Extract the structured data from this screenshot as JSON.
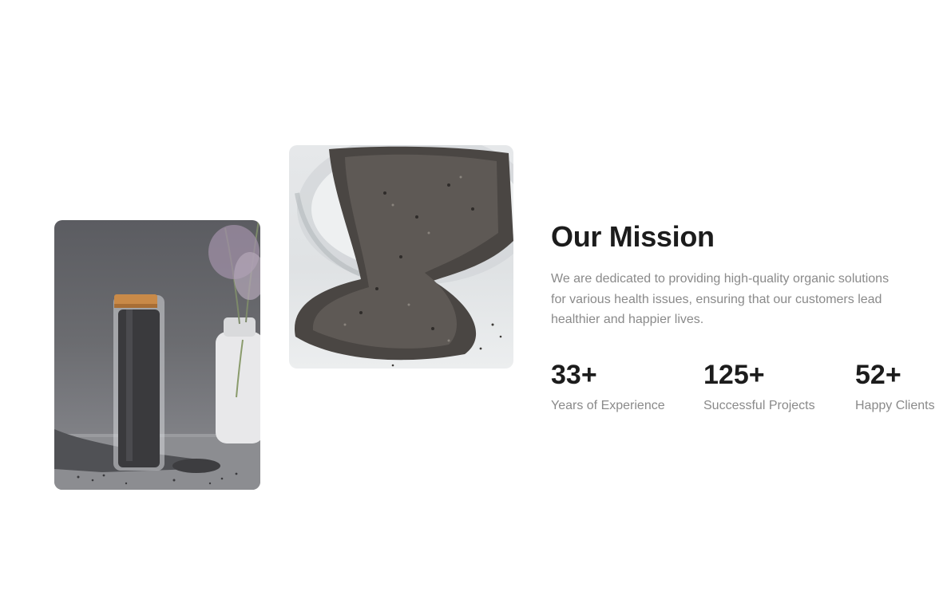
{
  "images": {
    "bottle": {
      "icon": "chia-bottle-photo",
      "alt": "Glass bottle of chia seeds"
    },
    "seeds": {
      "icon": "chia-seeds-jar-photo",
      "alt": "Chia seeds spilling from jar"
    }
  },
  "mission": {
    "title": "Our Mission",
    "description": "We are dedicated to providing high-quality organic solutions for various health issues, ensuring that our customers lead healthier and happier lives."
  },
  "stats": [
    {
      "value": "33+",
      "label": "Years of Experience"
    },
    {
      "value": "125+",
      "label": "Successful Projects"
    },
    {
      "value": "52+",
      "label": "Happy Clients"
    }
  ],
  "colors": {
    "heading": "#1c1c1c",
    "body_text": "#8a8a8a",
    "cork": "#c98a48"
  }
}
